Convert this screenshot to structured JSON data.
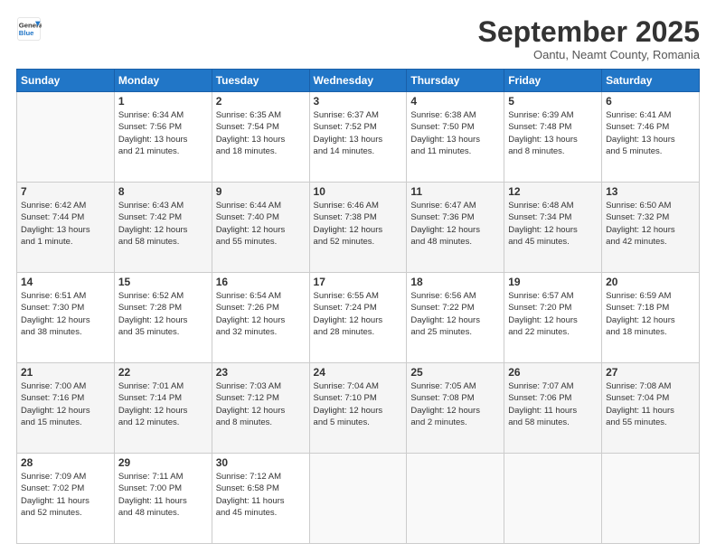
{
  "logo": {
    "line1": "General",
    "line2": "Blue"
  },
  "header": {
    "month": "September 2025",
    "location": "Oantu, Neamt County, Romania"
  },
  "weekdays": [
    "Sunday",
    "Monday",
    "Tuesday",
    "Wednesday",
    "Thursday",
    "Friday",
    "Saturday"
  ],
  "weeks": [
    [
      {
        "day": "",
        "text": ""
      },
      {
        "day": "1",
        "text": "Sunrise: 6:34 AM\nSunset: 7:56 PM\nDaylight: 13 hours\nand 21 minutes."
      },
      {
        "day": "2",
        "text": "Sunrise: 6:35 AM\nSunset: 7:54 PM\nDaylight: 13 hours\nand 18 minutes."
      },
      {
        "day": "3",
        "text": "Sunrise: 6:37 AM\nSunset: 7:52 PM\nDaylight: 13 hours\nand 14 minutes."
      },
      {
        "day": "4",
        "text": "Sunrise: 6:38 AM\nSunset: 7:50 PM\nDaylight: 13 hours\nand 11 minutes."
      },
      {
        "day": "5",
        "text": "Sunrise: 6:39 AM\nSunset: 7:48 PM\nDaylight: 13 hours\nand 8 minutes."
      },
      {
        "day": "6",
        "text": "Sunrise: 6:41 AM\nSunset: 7:46 PM\nDaylight: 13 hours\nand 5 minutes."
      }
    ],
    [
      {
        "day": "7",
        "text": "Sunrise: 6:42 AM\nSunset: 7:44 PM\nDaylight: 13 hours\nand 1 minute."
      },
      {
        "day": "8",
        "text": "Sunrise: 6:43 AM\nSunset: 7:42 PM\nDaylight: 12 hours\nand 58 minutes."
      },
      {
        "day": "9",
        "text": "Sunrise: 6:44 AM\nSunset: 7:40 PM\nDaylight: 12 hours\nand 55 minutes."
      },
      {
        "day": "10",
        "text": "Sunrise: 6:46 AM\nSunset: 7:38 PM\nDaylight: 12 hours\nand 52 minutes."
      },
      {
        "day": "11",
        "text": "Sunrise: 6:47 AM\nSunset: 7:36 PM\nDaylight: 12 hours\nand 48 minutes."
      },
      {
        "day": "12",
        "text": "Sunrise: 6:48 AM\nSunset: 7:34 PM\nDaylight: 12 hours\nand 45 minutes."
      },
      {
        "day": "13",
        "text": "Sunrise: 6:50 AM\nSunset: 7:32 PM\nDaylight: 12 hours\nand 42 minutes."
      }
    ],
    [
      {
        "day": "14",
        "text": "Sunrise: 6:51 AM\nSunset: 7:30 PM\nDaylight: 12 hours\nand 38 minutes."
      },
      {
        "day": "15",
        "text": "Sunrise: 6:52 AM\nSunset: 7:28 PM\nDaylight: 12 hours\nand 35 minutes."
      },
      {
        "day": "16",
        "text": "Sunrise: 6:54 AM\nSunset: 7:26 PM\nDaylight: 12 hours\nand 32 minutes."
      },
      {
        "day": "17",
        "text": "Sunrise: 6:55 AM\nSunset: 7:24 PM\nDaylight: 12 hours\nand 28 minutes."
      },
      {
        "day": "18",
        "text": "Sunrise: 6:56 AM\nSunset: 7:22 PM\nDaylight: 12 hours\nand 25 minutes."
      },
      {
        "day": "19",
        "text": "Sunrise: 6:57 AM\nSunset: 7:20 PM\nDaylight: 12 hours\nand 22 minutes."
      },
      {
        "day": "20",
        "text": "Sunrise: 6:59 AM\nSunset: 7:18 PM\nDaylight: 12 hours\nand 18 minutes."
      }
    ],
    [
      {
        "day": "21",
        "text": "Sunrise: 7:00 AM\nSunset: 7:16 PM\nDaylight: 12 hours\nand 15 minutes."
      },
      {
        "day": "22",
        "text": "Sunrise: 7:01 AM\nSunset: 7:14 PM\nDaylight: 12 hours\nand 12 minutes."
      },
      {
        "day": "23",
        "text": "Sunrise: 7:03 AM\nSunset: 7:12 PM\nDaylight: 12 hours\nand 8 minutes."
      },
      {
        "day": "24",
        "text": "Sunrise: 7:04 AM\nSunset: 7:10 PM\nDaylight: 12 hours\nand 5 minutes."
      },
      {
        "day": "25",
        "text": "Sunrise: 7:05 AM\nSunset: 7:08 PM\nDaylight: 12 hours\nand 2 minutes."
      },
      {
        "day": "26",
        "text": "Sunrise: 7:07 AM\nSunset: 7:06 PM\nDaylight: 11 hours\nand 58 minutes."
      },
      {
        "day": "27",
        "text": "Sunrise: 7:08 AM\nSunset: 7:04 PM\nDaylight: 11 hours\nand 55 minutes."
      }
    ],
    [
      {
        "day": "28",
        "text": "Sunrise: 7:09 AM\nSunset: 7:02 PM\nDaylight: 11 hours\nand 52 minutes."
      },
      {
        "day": "29",
        "text": "Sunrise: 7:11 AM\nSunset: 7:00 PM\nDaylight: 11 hours\nand 48 minutes."
      },
      {
        "day": "30",
        "text": "Sunrise: 7:12 AM\nSunset: 6:58 PM\nDaylight: 11 hours\nand 45 minutes."
      },
      {
        "day": "",
        "text": ""
      },
      {
        "day": "",
        "text": ""
      },
      {
        "day": "",
        "text": ""
      },
      {
        "day": "",
        "text": ""
      }
    ]
  ]
}
